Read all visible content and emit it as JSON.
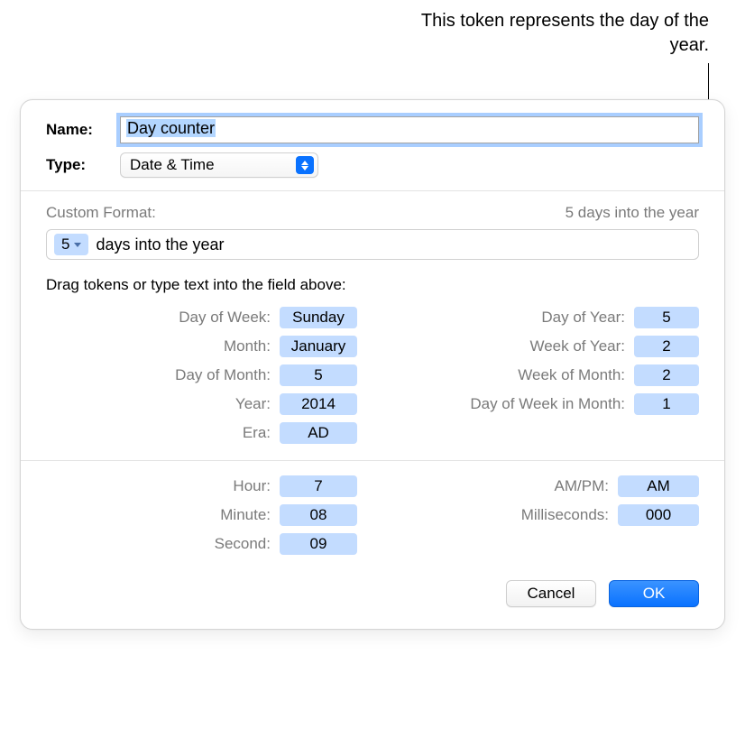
{
  "annotation": {
    "text": "This token represents the day of the year."
  },
  "name": {
    "label": "Name:",
    "value": "Day counter"
  },
  "type": {
    "label": "Type:",
    "value": "Date & Time"
  },
  "customFormat": {
    "label": "Custom Format:",
    "preview": "5 days into the year",
    "tokenValue": "5",
    "trailingText": "days into the year"
  },
  "dragHint": "Drag tokens or type text into the field above:",
  "dateTokens": {
    "left": [
      {
        "label": "Day of Week:",
        "value": "Sunday"
      },
      {
        "label": "Month:",
        "value": "January"
      },
      {
        "label": "Day of Month:",
        "value": "5"
      },
      {
        "label": "Year:",
        "value": "2014"
      },
      {
        "label": "Era:",
        "value": "AD"
      }
    ],
    "right": [
      {
        "label": "Day of Year:",
        "value": "5"
      },
      {
        "label": "Week of Year:",
        "value": "2"
      },
      {
        "label": "Week of Month:",
        "value": "2"
      },
      {
        "label": "Day of Week in Month:",
        "value": "1"
      }
    ]
  },
  "timeTokens": {
    "left": [
      {
        "label": "Hour:",
        "value": "7"
      },
      {
        "label": "Minute:",
        "value": "08"
      },
      {
        "label": "Second:",
        "value": "09"
      }
    ],
    "right": [
      {
        "label": "AM/PM:",
        "value": "AM"
      },
      {
        "label": "Milliseconds:",
        "value": "000"
      }
    ]
  },
  "buttons": {
    "cancel": "Cancel",
    "ok": "OK"
  }
}
